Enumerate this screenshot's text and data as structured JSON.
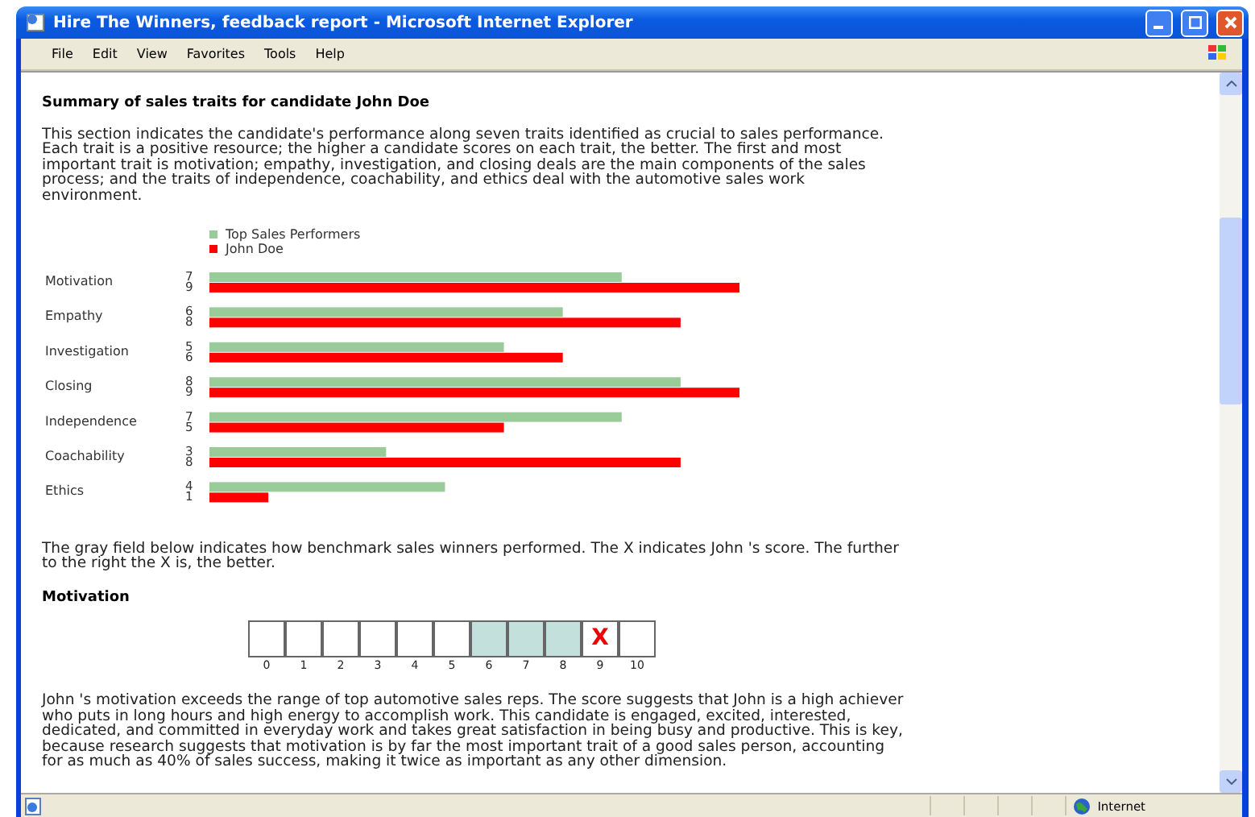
{
  "window": {
    "title": "Hire The Winners, feedback report - Microsoft Internet Explorer"
  },
  "menu": [
    {
      "label": "File"
    },
    {
      "label": "Edit"
    },
    {
      "label": "View"
    },
    {
      "label": "Favorites"
    },
    {
      "label": "Tools"
    },
    {
      "label": "Help"
    }
  ],
  "report": {
    "heading": "Summary of sales traits for candidate John Doe",
    "intro": "This section indicates the candidate's performance along seven traits identified as crucial to sales performance. Each trait is a positive resource; the higher a candidate scores on each trait, the better. The first and most important trait is motivation; empathy, investigation, and closing deals are the main components of the sales process; and the traits of independence, coachability, and ethics deal with the automotive sales work environment.",
    "chart_data": {
      "type": "bar",
      "orientation": "horizontal",
      "data_labels": true,
      "categories": [
        "Motivation",
        "Empathy",
        "Investigation",
        "Closing",
        "Independence",
        "Coachability",
        "Ethics"
      ],
      "xlim": [
        0,
        9
      ],
      "legend": true,
      "series": [
        {
          "name": "Top Sales Performers",
          "color": "#99cc99",
          "values": [
            7,
            6,
            5,
            8,
            7,
            3,
            4
          ]
        },
        {
          "name": "John Doe",
          "color": "#ff0000",
          "values": [
            9,
            8,
            6,
            9,
            5,
            8,
            1
          ]
        }
      ]
    },
    "scale_note": "The gray field below indicates how benchmark sales winners performed. The X indicates John 's score. The further to the right the X is, the better.",
    "trait": {
      "name": "Motivation",
      "mark": "X",
      "cells": [
        {
          "label": "0",
          "in_range": false,
          "marked": false
        },
        {
          "label": "1",
          "in_range": false,
          "marked": false
        },
        {
          "label": "2",
          "in_range": false,
          "marked": false
        },
        {
          "label": "3",
          "in_range": false,
          "marked": false
        },
        {
          "label": "4",
          "in_range": false,
          "marked": false
        },
        {
          "label": "5",
          "in_range": false,
          "marked": false
        },
        {
          "label": "6",
          "in_range": true,
          "marked": false
        },
        {
          "label": "7",
          "in_range": true,
          "marked": false
        },
        {
          "label": "8",
          "in_range": true,
          "marked": false
        },
        {
          "label": "9",
          "in_range": false,
          "marked": true
        },
        {
          "label": "10",
          "in_range": false,
          "marked": false
        }
      ],
      "description": "John 's motivation exceeds the range of top automotive sales reps. The score suggests that John is a high achiever who puts in long hours and high energy to accomplish work. This candidate is engaged, excited, interested, dedicated, and committed in everyday work and takes great satisfaction in being busy and productive. This is key, because research suggests that motivation is by far the most important trait of a good sales person, accounting for as much as 40% of sales success, making it twice as important as any other dimension."
    }
  },
  "status_bar": {
    "zone": "Internet"
  }
}
